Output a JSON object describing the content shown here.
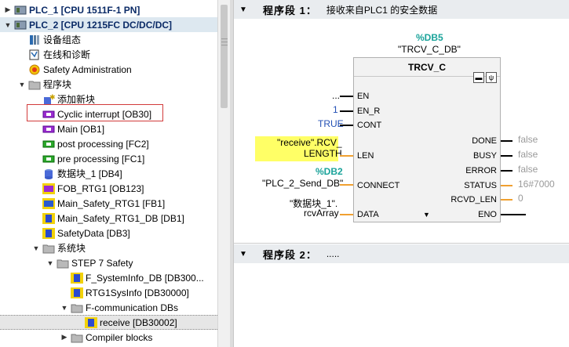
{
  "tree": [
    {
      "label": "PLC_1 [CPU 1511F-1 PN]",
      "indent": 0,
      "toggle": "▶",
      "icon": "plc-icon",
      "bold": true
    },
    {
      "label": "PLC_2 [CPU 1215FC DC/DC/DC]",
      "indent": 0,
      "toggle": "▼",
      "icon": "plc-icon",
      "bold": true,
      "highlight": true
    },
    {
      "label": "设备组态",
      "indent": 1,
      "toggle": "",
      "icon": "device-config-icon"
    },
    {
      "label": "在线和诊断",
      "indent": 1,
      "toggle": "",
      "icon": "online-diagnostics-icon"
    },
    {
      "label": "Safety Administration",
      "indent": 1,
      "toggle": "",
      "icon": "safety-admin-icon"
    },
    {
      "label": "程序块",
      "indent": 1,
      "toggle": "▼",
      "icon": "folder-icon"
    },
    {
      "label": "添加新块",
      "indent": 2,
      "toggle": "",
      "icon": "add-block-icon"
    },
    {
      "label": "Cyclic interrupt [OB30]",
      "indent": 2,
      "toggle": "",
      "icon": "ob-icon"
    },
    {
      "label": "Main [OB1]",
      "indent": 2,
      "toggle": "",
      "icon": "ob-icon"
    },
    {
      "label": "post processing [FC2]",
      "indent": 2,
      "toggle": "",
      "icon": "fc-icon"
    },
    {
      "label": "pre processing [FC1]",
      "indent": 2,
      "toggle": "",
      "icon": "fc-icon"
    },
    {
      "label": "数据块_1 [DB4]",
      "indent": 2,
      "toggle": "",
      "icon": "db-icon"
    },
    {
      "label": "FOB_RTG1 [OB123]",
      "indent": 2,
      "toggle": "",
      "icon": "safety-ob-icon"
    },
    {
      "label": "Main_Safety_RTG1 [FB1]",
      "indent": 2,
      "toggle": "",
      "icon": "safety-fb-icon"
    },
    {
      "label": "Main_Safety_RTG1_DB [DB1]",
      "indent": 2,
      "toggle": "",
      "icon": "safety-db-icon"
    },
    {
      "label": "SafetyData [DB3]",
      "indent": 2,
      "toggle": "",
      "icon": "safety-db-icon"
    },
    {
      "label": "系统块",
      "indent": 2,
      "toggle": "▼",
      "icon": "folder-icon"
    },
    {
      "label": "STEP 7 Safety",
      "indent": 3,
      "toggle": "▼",
      "icon": "folder-icon"
    },
    {
      "label": "F_SystemInfo_DB [DB300...",
      "indent": 4,
      "toggle": "",
      "icon": "safety-db-icon"
    },
    {
      "label": "RTG1SysInfo [DB30000]",
      "indent": 4,
      "toggle": "",
      "icon": "safety-db-icon"
    },
    {
      "label": "F-communication DBs",
      "indent": 4,
      "toggle": "▼",
      "icon": "folder-icon"
    },
    {
      "label": "receive [DB30002]",
      "indent": 5,
      "toggle": "",
      "icon": "safety-db-icon",
      "selected": true
    },
    {
      "label": "Compiler blocks",
      "indent": 4,
      "toggle": "▶",
      "icon": "folder-icon"
    }
  ],
  "network1": {
    "arrow": "▼",
    "title": "程序段 1：",
    "comment": "接收来自PLC1 的安全数据",
    "instance_addr": "%DB5",
    "instance_name": "\"TRCV_C_DB\"",
    "block_name": "TRCV_C",
    "inputs": {
      "en_val": "...",
      "en_r_val": "1",
      "cont_val": "TRUE",
      "len_val_1": "\"receive\".RCV_",
      "len_val_2": "LENGTH",
      "connect_addr": "%DB2",
      "connect_val": "\"PLC_2_Send_DB\"",
      "data_val_1": "\"数据块_1\".",
      "data_val_2": "rcvArray"
    },
    "pins_in": {
      "en": "EN",
      "en_r": "EN_R",
      "cont": "CONT",
      "len": "LEN",
      "connect": "CONNECT",
      "data": "DATA"
    },
    "pins_out": {
      "done": "DONE",
      "busy": "BUSY",
      "error": "ERROR",
      "status": "STATUS",
      "rcvd_len": "RCVD_LEN",
      "eno": "ENO"
    },
    "outputs": {
      "done": "false",
      "busy": "false",
      "error": "false",
      "status": "16#7000",
      "rcvd_len": "0"
    }
  },
  "network2": {
    "arrow": "▼",
    "title": "程序段 2：",
    "comment": "....."
  }
}
